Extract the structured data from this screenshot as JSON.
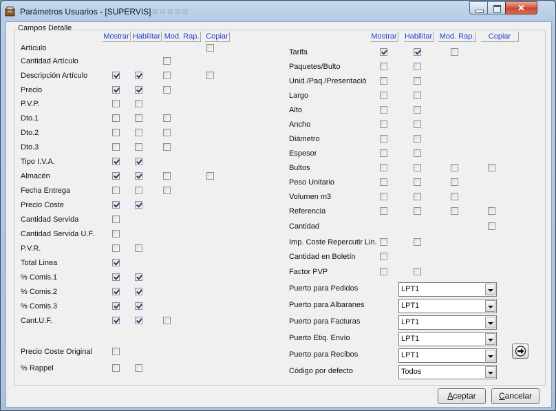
{
  "window": {
    "title": "Parámetros Usuarios - [SUPERVIS]"
  },
  "groupbox": {
    "label": "Campos Detalle"
  },
  "columns": {
    "mostrar": "Mostrar",
    "habilitar": "Habilitar",
    "mod_rap": "Mod. Rap.",
    "copiar": "Copiar"
  },
  "left_fields": [
    {
      "label": "Artículo",
      "mostrar": null,
      "habilitar": null,
      "mod_rap": null,
      "copiar": false
    },
    {
      "label": "Cantidad Artículo",
      "mostrar": null,
      "habilitar": null,
      "mod_rap": false,
      "copiar": null
    },
    {
      "label": "Descripción Artículo",
      "mostrar": true,
      "habilitar": true,
      "mod_rap": false,
      "copiar": false
    },
    {
      "label": "Precio",
      "mostrar": true,
      "habilitar": true,
      "mod_rap": false,
      "copiar": null
    },
    {
      "label": "P.V.P.",
      "mostrar": false,
      "habilitar": false,
      "mod_rap": null,
      "copiar": null
    },
    {
      "label": "Dto.1",
      "mostrar": false,
      "habilitar": false,
      "mod_rap": false,
      "copiar": null
    },
    {
      "label": "Dto.2",
      "mostrar": false,
      "habilitar": false,
      "mod_rap": false,
      "copiar": null
    },
    {
      "label": "Dto.3",
      "mostrar": false,
      "habilitar": false,
      "mod_rap": false,
      "copiar": null
    },
    {
      "label": "Tipo I.V.A.",
      "mostrar": true,
      "habilitar": true,
      "mod_rap": null,
      "copiar": null
    },
    {
      "label": "Almacén",
      "mostrar": true,
      "habilitar": true,
      "mod_rap": false,
      "copiar": false
    },
    {
      "label": "Fecha Entrega",
      "mostrar": false,
      "habilitar": false,
      "mod_rap": false,
      "copiar": null
    },
    {
      "label": "Precio Coste",
      "mostrar": true,
      "habilitar": true,
      "mod_rap": null,
      "copiar": null
    },
    {
      "label": "Cantidad Servida",
      "mostrar": false,
      "habilitar": null,
      "mod_rap": null,
      "copiar": null
    },
    {
      "label": "Cantidad Servida U.F.",
      "mostrar": false,
      "habilitar": null,
      "mod_rap": null,
      "copiar": null
    },
    {
      "label": "P.V.R.",
      "mostrar": false,
      "habilitar": false,
      "mod_rap": null,
      "copiar": null
    },
    {
      "label": "Total Linea",
      "mostrar": true,
      "habilitar": null,
      "mod_rap": null,
      "copiar": null
    },
    {
      "label": "% Comis.1",
      "mostrar": true,
      "habilitar": true,
      "mod_rap": null,
      "copiar": null
    },
    {
      "label": "% Comis.2",
      "mostrar": true,
      "habilitar": true,
      "mod_rap": null,
      "copiar": null
    },
    {
      "label": "% Comis.3",
      "mostrar": true,
      "habilitar": true,
      "mod_rap": null,
      "copiar": null
    },
    {
      "label": "Cant.U.F.",
      "mostrar": true,
      "habilitar": true,
      "mod_rap": false,
      "copiar": null
    },
    {
      "label": "Precio Coste Original",
      "mostrar": false,
      "habilitar": null,
      "mod_rap": null,
      "copiar": null
    },
    {
      "label": "% Rappel",
      "mostrar": false,
      "habilitar": false,
      "mod_rap": null,
      "copiar": null
    }
  ],
  "right_fields": [
    {
      "label": "Tarifa",
      "mostrar": true,
      "habilitar": true,
      "mod_rap": false,
      "copiar": null
    },
    {
      "label": "Paquetes/Bulto",
      "mostrar": false,
      "habilitar": false,
      "mod_rap": null,
      "copiar": null
    },
    {
      "label": "Unid./Paq./Presentació",
      "mostrar": false,
      "habilitar": false,
      "mod_rap": null,
      "copiar": null
    },
    {
      "label": "Largo",
      "mostrar": false,
      "habilitar": false,
      "mod_rap": null,
      "copiar": null
    },
    {
      "label": "Alto",
      "mostrar": false,
      "habilitar": false,
      "mod_rap": null,
      "copiar": null
    },
    {
      "label": "Ancho",
      "mostrar": false,
      "habilitar": false,
      "mod_rap": null,
      "copiar": null
    },
    {
      "label": "Diámetro",
      "mostrar": false,
      "habilitar": false,
      "mod_rap": null,
      "copiar": null
    },
    {
      "label": "Espesor",
      "mostrar": false,
      "habilitar": false,
      "mod_rap": null,
      "copiar": null
    },
    {
      "label": "Bultos",
      "mostrar": false,
      "habilitar": false,
      "mod_rap": false,
      "copiar": false
    },
    {
      "label": "Peso Unitario",
      "mostrar": false,
      "habilitar": false,
      "mod_rap": false,
      "copiar": null
    },
    {
      "label": "Volumen m3",
      "mostrar": false,
      "habilitar": false,
      "mod_rap": false,
      "copiar": null
    },
    {
      "label": "Referencia",
      "mostrar": false,
      "habilitar": false,
      "mod_rap": false,
      "copiar": false
    },
    {
      "label": "Cantidad",
      "mostrar": null,
      "habilitar": null,
      "mod_rap": null,
      "copiar": false
    },
    {
      "label": "Imp. Coste Repercutir Lin.",
      "mostrar": false,
      "habilitar": false,
      "mod_rap": null,
      "copiar": null
    },
    {
      "label": "Cantidad en Boletín",
      "mostrar": false,
      "habilitar": null,
      "mod_rap": null,
      "copiar": null
    },
    {
      "label": "Factor PVP",
      "mostrar": false,
      "habilitar": false,
      "mod_rap": null,
      "copiar": null
    }
  ],
  "ports": [
    {
      "label": "Puerto para Pedidos",
      "value": "LPT1"
    },
    {
      "label": "Puerto para Albaranes",
      "value": "LPT1"
    },
    {
      "label": "Puerto para Facturas",
      "value": "LPT1"
    },
    {
      "label": "Puerto Etiq. Envío",
      "value": "LPT1"
    },
    {
      "label": "Puerto para Recibos",
      "value": "LPT1"
    },
    {
      "label": "Código por defecto",
      "value": "Todos"
    }
  ],
  "icons": {
    "next": "arrow-right-icon",
    "app": "app-icon"
  },
  "buttons": {
    "accept_hotkey": "A",
    "accept_rest": "ceptar",
    "cancel_hotkey": "C",
    "cancel_rest": "ancelar"
  }
}
